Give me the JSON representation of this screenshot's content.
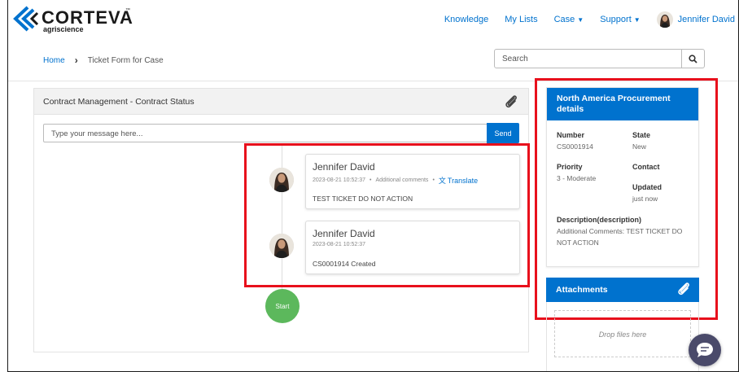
{
  "brand": {
    "name": "CORTEVA",
    "tm": "™",
    "sub": "agriscience",
    "accent": "#0072ce"
  },
  "topnav": {
    "knowledge": "Knowledge",
    "my_lists": "My Lists",
    "case": "Case",
    "support": "Support",
    "user": "Jennifer David"
  },
  "breadcrumb": {
    "home": "Home",
    "current": "Ticket Form for Case"
  },
  "search": {
    "placeholder": "Search"
  },
  "main": {
    "title": "Contract Management - Contract Status",
    "message_placeholder": "Type your message here...",
    "send_label": "Send",
    "feed": [
      {
        "author": "Jennifer David",
        "timestamp": "2023-08-21 10:52:37",
        "type": "Additional comments",
        "translate": "Translate",
        "body": "TEST TICKET DO NOT ACTION"
      },
      {
        "author": "Jennifer David",
        "timestamp": "2023-08-21 10:52:37",
        "body": "CS0001914 Created"
      }
    ],
    "start_label": "Start"
  },
  "details": {
    "title_line1": "North America Procurement",
    "title_line2": "details",
    "number_label": "Number",
    "number_value": "CS0001914",
    "state_label": "State",
    "state_value": "New",
    "priority_label": "Priority",
    "priority_value": "3 - Moderate",
    "contact_label": "Contact",
    "updated_label": "Updated",
    "updated_value": "just now",
    "description_label": "Description(description)",
    "description_value_line1": "Additional Comments: TEST TICKET DO",
    "description_value_line2": "NOT ACTION"
  },
  "attachments": {
    "title": "Attachments",
    "drop_text": "Drop files here"
  },
  "icons": {
    "search": "search-icon",
    "paperclip": "paperclip-icon",
    "chat": "chat-icon",
    "translate": "translate-icon"
  }
}
